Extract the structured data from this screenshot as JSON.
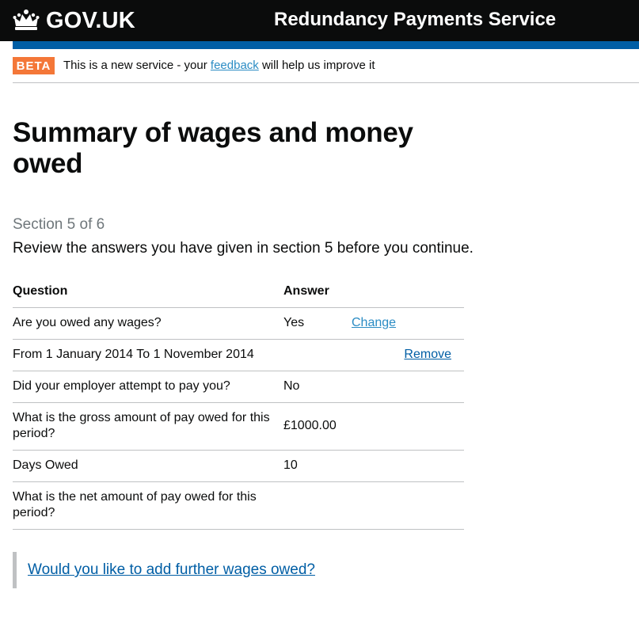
{
  "header": {
    "logo_text": "GOV.UK",
    "service_name": "Redundancy Payments Service",
    "colors": {
      "background": "#0b0c0c",
      "bar": "#005ea5"
    }
  },
  "phase_banner": {
    "tag": "BETA",
    "text_before": "This is a new service - your",
    "link": "feedback",
    "text_after": "will help us improve it",
    "tag_color": "#f47738"
  },
  "page": {
    "title": "Summary of wages and money owed",
    "section_caption": "Section 5 of 6",
    "lead": "Review the answers you have given in section 5 before you continue."
  },
  "table": {
    "headers": {
      "question": "Question",
      "answer": "Answer"
    },
    "rows": [
      {
        "question": "Are you owed any wages?",
        "answer": "Yes",
        "action": "Change"
      },
      {
        "question": "From 1 January 2014 To 1 November 2014",
        "answer": "",
        "action": "Remove"
      },
      {
        "question": "Did your employer attempt to pay you?",
        "answer": "No",
        "action": ""
      },
      {
        "question": "What is the gross amount of pay owed for this period?",
        "answer": "£1000.00",
        "action": ""
      },
      {
        "question": "Days Owed",
        "answer": "10",
        "action": ""
      },
      {
        "question": "What is the net amount of pay owed for this period?",
        "answer": "",
        "action": ""
      }
    ]
  },
  "further": {
    "link": "Would you like to add further wages owed?"
  }
}
